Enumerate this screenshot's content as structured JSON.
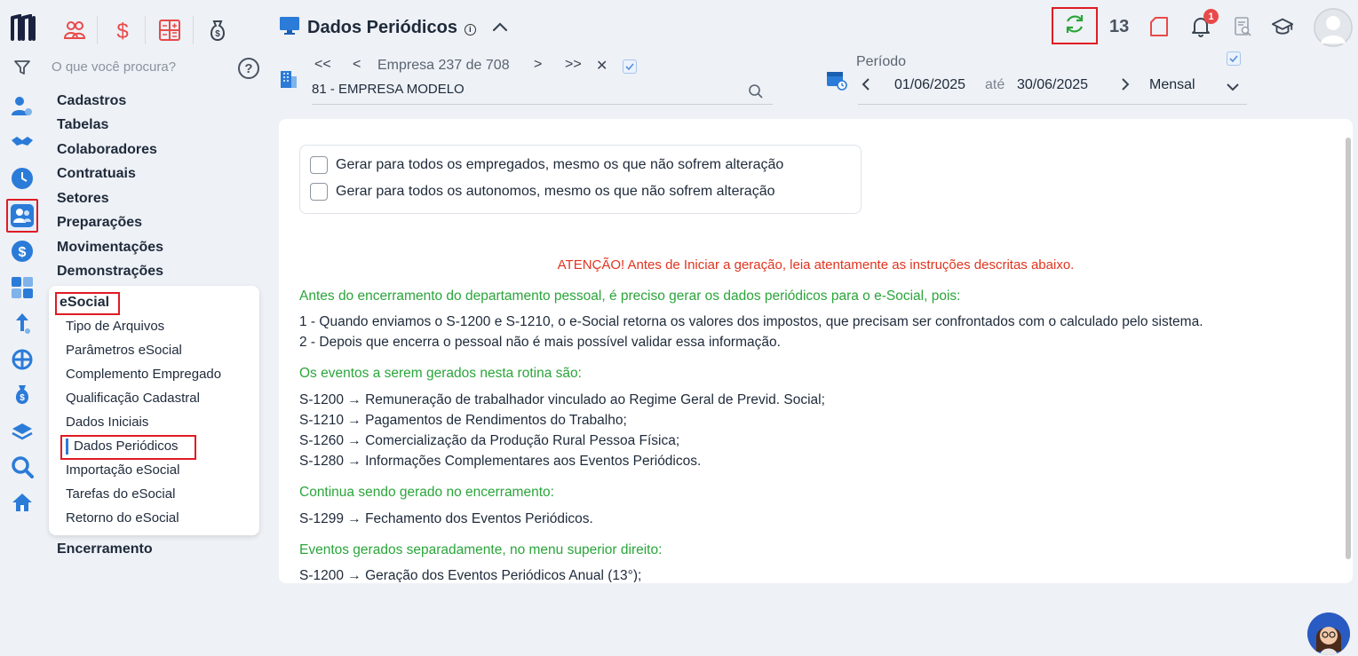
{
  "app": {
    "search_placeholder": "O que você procura?"
  },
  "header": {
    "title": "Dados Periódicos",
    "counter": "13",
    "notification_count": "1"
  },
  "company": {
    "nav_first": "<<",
    "nav_prev": "<",
    "label": "Empresa",
    "current": "237",
    "of": "de",
    "total": "708",
    "nav_next": ">",
    "nav_last": ">>",
    "clear": "✕",
    "selected": "81 - EMPRESA MODELO"
  },
  "period": {
    "label": "Período",
    "start": "01/06/2025",
    "until": "até",
    "end": "30/06/2025",
    "frequency": "Mensal"
  },
  "sidebar": {
    "menu": [
      "Cadastros",
      "Tabelas",
      "Colaboradores",
      "Contratuais",
      "Setores",
      "Preparações",
      "Movimentações",
      "Demonstrações"
    ],
    "esocial_title": "eSocial",
    "esocial_items": [
      "Tipo de Arquivos",
      "Parâmetros eSocial",
      "Complemento Empregado",
      "Qualificação Cadastral",
      "Dados Iniciais",
      "Dados Periódicos",
      "Importação eSocial",
      "Tarefas do eSocial",
      "Retorno do eSocial"
    ],
    "after": "Encerramento"
  },
  "options": {
    "opt1": "Gerar para todos os empregados, mesmo os que não sofrem alteração",
    "opt2": "Gerar para todos os autonomos, mesmo os que não sofrem alteração"
  },
  "content": {
    "warning": "ATENÇÃO! Antes de Iniciar a geração, leia atentamente as instruções descritas abaixo.",
    "h1": "Antes do encerramento do departamento pessoal, é preciso gerar os dados periódicos para o e-Social, pois:",
    "l1": "1 - Quando enviamos o S-1200 e S-1210, o e-Social retorna os valores dos impostos, que precisam ser confrontados com o calculado pelo sistema.",
    "l2": "2 - Depois que encerra o pessoal não é mais possível validar essa informação.",
    "h2": "Os eventos a serem gerados nesta rotina são:",
    "e1": "S-1200 → Remuneração de trabalhador vinculado ao Regime Geral de Previd. Social;",
    "e2": "S-1210  → Pagamentos de Rendimentos do Trabalho;",
    "e3": "S-1260 → Comercialização da Produção Rural Pessoa Física;",
    "e4": "S-1280 → Informações Complementares aos Eventos Periódicos.",
    "h3": "Continua sendo gerado no encerramento:",
    "c1": "S-1299 → Fechamento dos Eventos Periódicos.",
    "h4": "Eventos gerados separadamente, no menu superior direito:",
    "s1": "S-1200 → Geração dos Eventos Periódicos Anual (13°);"
  }
}
